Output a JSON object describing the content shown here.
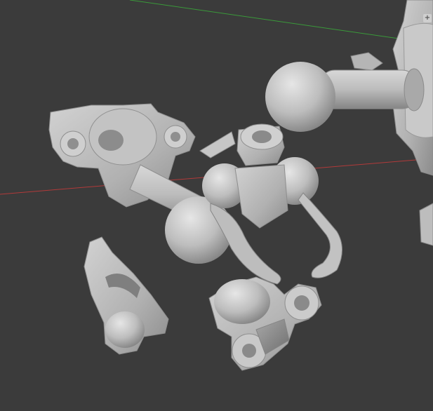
{
  "viewport": {
    "background_color": "#3b3b3b",
    "model_color": "#c8c8c8",
    "x_axis_color": "#b23a3a",
    "y_axis_color": "#3a9a3a"
  },
  "gizmo": {
    "button_label": "+",
    "icon": "plus-icon"
  }
}
